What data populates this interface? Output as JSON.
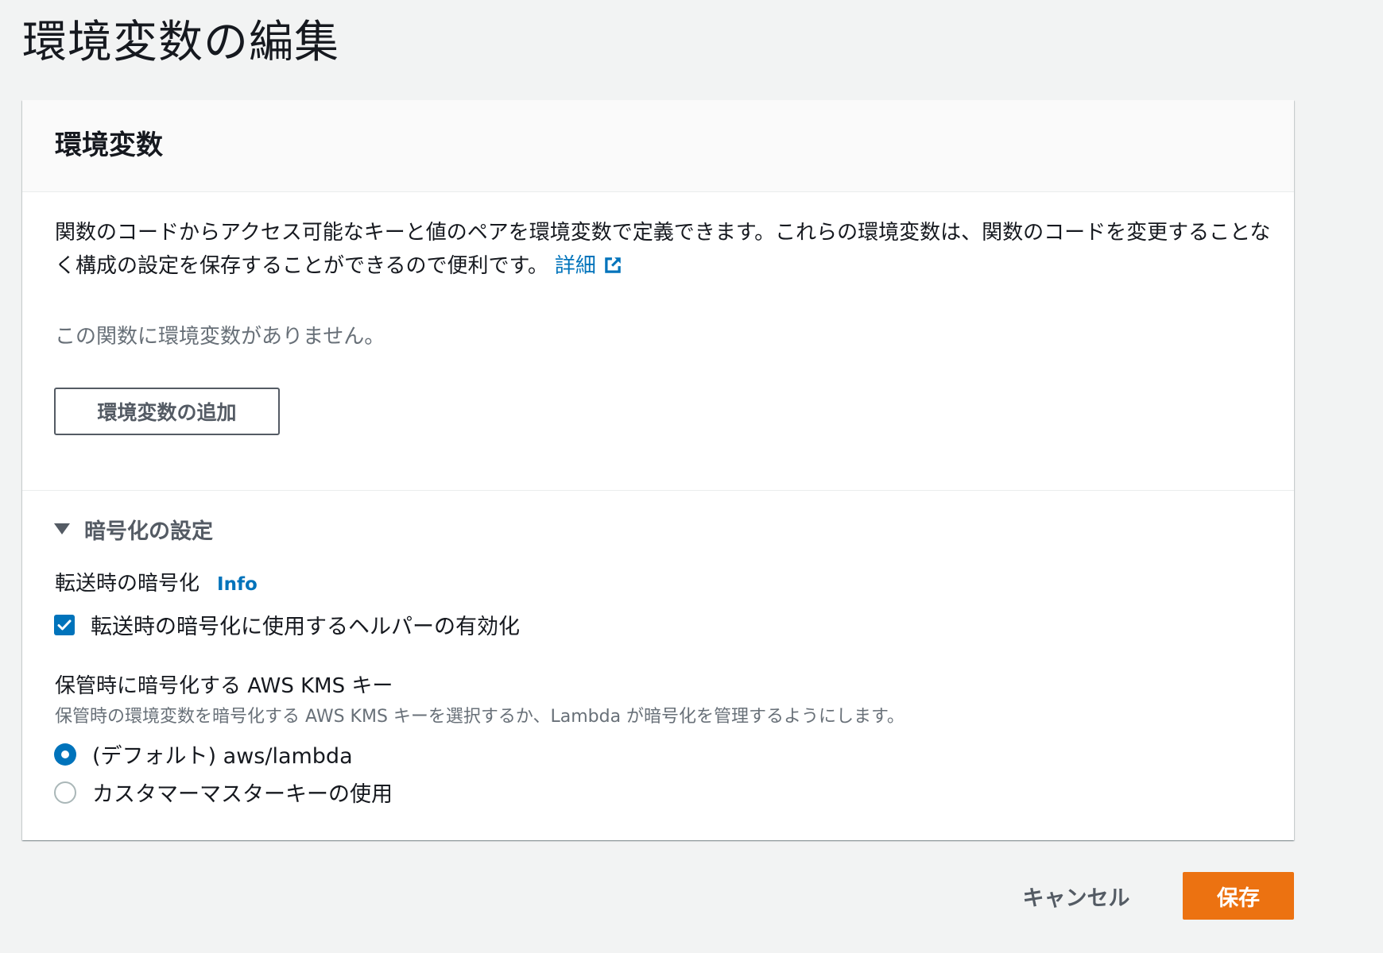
{
  "page": {
    "title": "環境変数の編集"
  },
  "panel": {
    "title": "環境変数",
    "description": "関数のコードからアクセス可能なキーと値のペアを環境変数で定義できます。これらの環境変数は、関数のコードを変更することなく構成の設定を保存することができるので便利です。",
    "detail_link": "詳細",
    "empty_message": "この関数に環境変数がありません。",
    "add_button_label": "環境変数の追加"
  },
  "encryption": {
    "section_title": "暗号化の設定",
    "expanded": true,
    "in_transit_label": "転送時の暗号化",
    "info_link": "Info",
    "helper_checkbox_label": "転送時の暗号化に使用するヘルパーの有効化",
    "helper_checkbox_checked": true,
    "kms_label": "保管時に暗号化する AWS KMS キー",
    "kms_description": "保管時の環境変数を暗号化する AWS KMS キーを選択するか、Lambda が暗号化を管理するようにします。",
    "options": [
      {
        "label": "(デフォルト) aws/lambda",
        "selected": true
      },
      {
        "label": "カスタマーマスターキーの使用",
        "selected": false
      }
    ]
  },
  "actions": {
    "cancel_label": "キャンセル",
    "save_label": "保存"
  },
  "colors": {
    "primary_button": "#ec7211",
    "link": "#0073bb",
    "background": "#f2f3f3"
  },
  "icons": {
    "external_link": "external-link-icon",
    "caret": "caret-down-icon",
    "check": "check-icon"
  }
}
